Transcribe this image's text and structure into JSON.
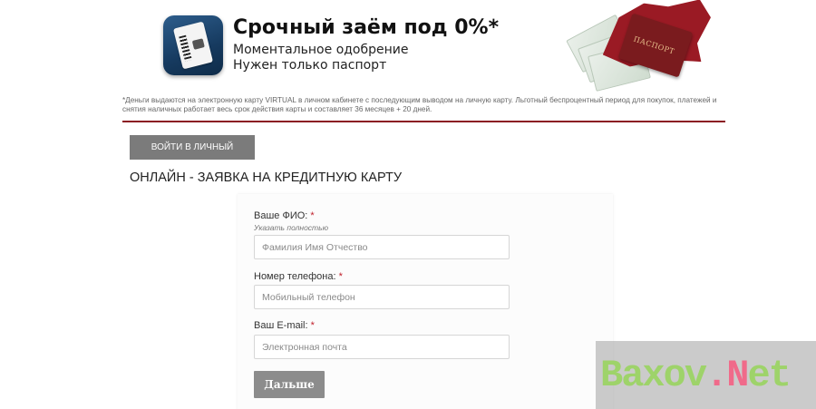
{
  "banner": {
    "title": "Срочный заём под 0%*",
    "line1": "Моментальное одобрение",
    "line2": "Нужен только паспорт",
    "passport_word": "ПАСПОРТ"
  },
  "disclaimer": "*Деньги выдаются на электронную карту VIRTUAL в личном кабинете с последующим выводом на личную карту. Льготный беспроцентный период для покупок, платежей и снятия наличных работает весь срок действия карты и составляет 36 месяцев + 20 дней.",
  "colors": {
    "divider": "#8b1a22",
    "button_gray": "#7b7b7b",
    "required_star": "#c0202b"
  },
  "cabinet_button": "ВОЙТИ В ЛИЧНЫЙ КАБИНЕТ",
  "section_title": "ОНЛАЙН - ЗАЯВКА НА КРЕДИТНУЮ КАРТУ",
  "form": {
    "name": {
      "label": "Ваше ФИО:",
      "required": "*",
      "hint": "Указать полностью",
      "placeholder": "Фамилия Имя Отчество",
      "value": ""
    },
    "phone": {
      "label": "Номер телефона:",
      "required": "*",
      "placeholder": "Мобильный телефон",
      "value": ""
    },
    "email": {
      "label": "Ваш E-mail:",
      "required": "*",
      "placeholder": "Электронная почта",
      "value": ""
    },
    "submit_label": "Дальше"
  },
  "watermark": {
    "part1": "Baxov",
    "part2": ".N",
    "part3": "et"
  },
  "icons": {
    "app_icon": "card-icon"
  }
}
